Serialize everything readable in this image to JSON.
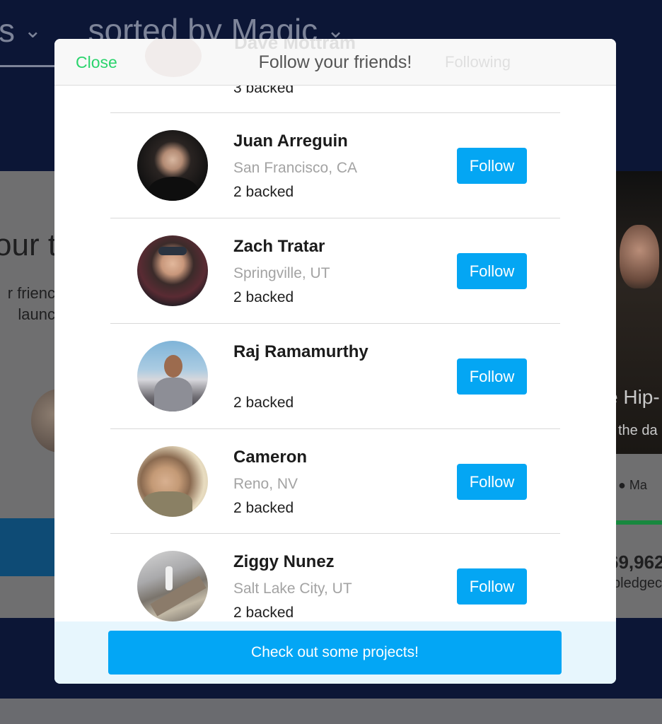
{
  "background": {
    "filter_left": "s",
    "filter_sort": "sorted by Magic",
    "left_title": "our t",
    "left_text_1": "r frienc",
    "left_text_2": "launc",
    "right_title": "e Hip-",
    "right_sub": "the da",
    "right_location": "Ma",
    "right_amount": "69,962",
    "right_amount_sub": "pledgec"
  },
  "modal": {
    "close_label": "Close",
    "title": "Follow your friends!",
    "ghost_name": "Dave Mottram",
    "ghost_following": "Following",
    "partial_backed": "3 backed",
    "cta_label": "Check out some projects!"
  },
  "friends": [
    {
      "name": "Juan Arreguin",
      "location": "San Francisco, CA",
      "backed": "2 backed",
      "button": "Follow"
    },
    {
      "name": "Zach Tratar",
      "location": "Springville, UT",
      "backed": "2 backed",
      "button": "Follow"
    },
    {
      "name": "Raj Ramamurthy",
      "location": "",
      "backed": "2 backed",
      "button": "Follow"
    },
    {
      "name": "Cameron",
      "location": "Reno, NV",
      "backed": "2 backed",
      "button": "Follow"
    },
    {
      "name": "Ziggy Nunez",
      "location": "Salt Lake City, UT",
      "backed": "2 backed",
      "button": "Follow"
    }
  ],
  "colors": {
    "follow_button": "#04a6f3",
    "close_text": "#2bd46d",
    "overlay_navy": "#0c1636"
  }
}
